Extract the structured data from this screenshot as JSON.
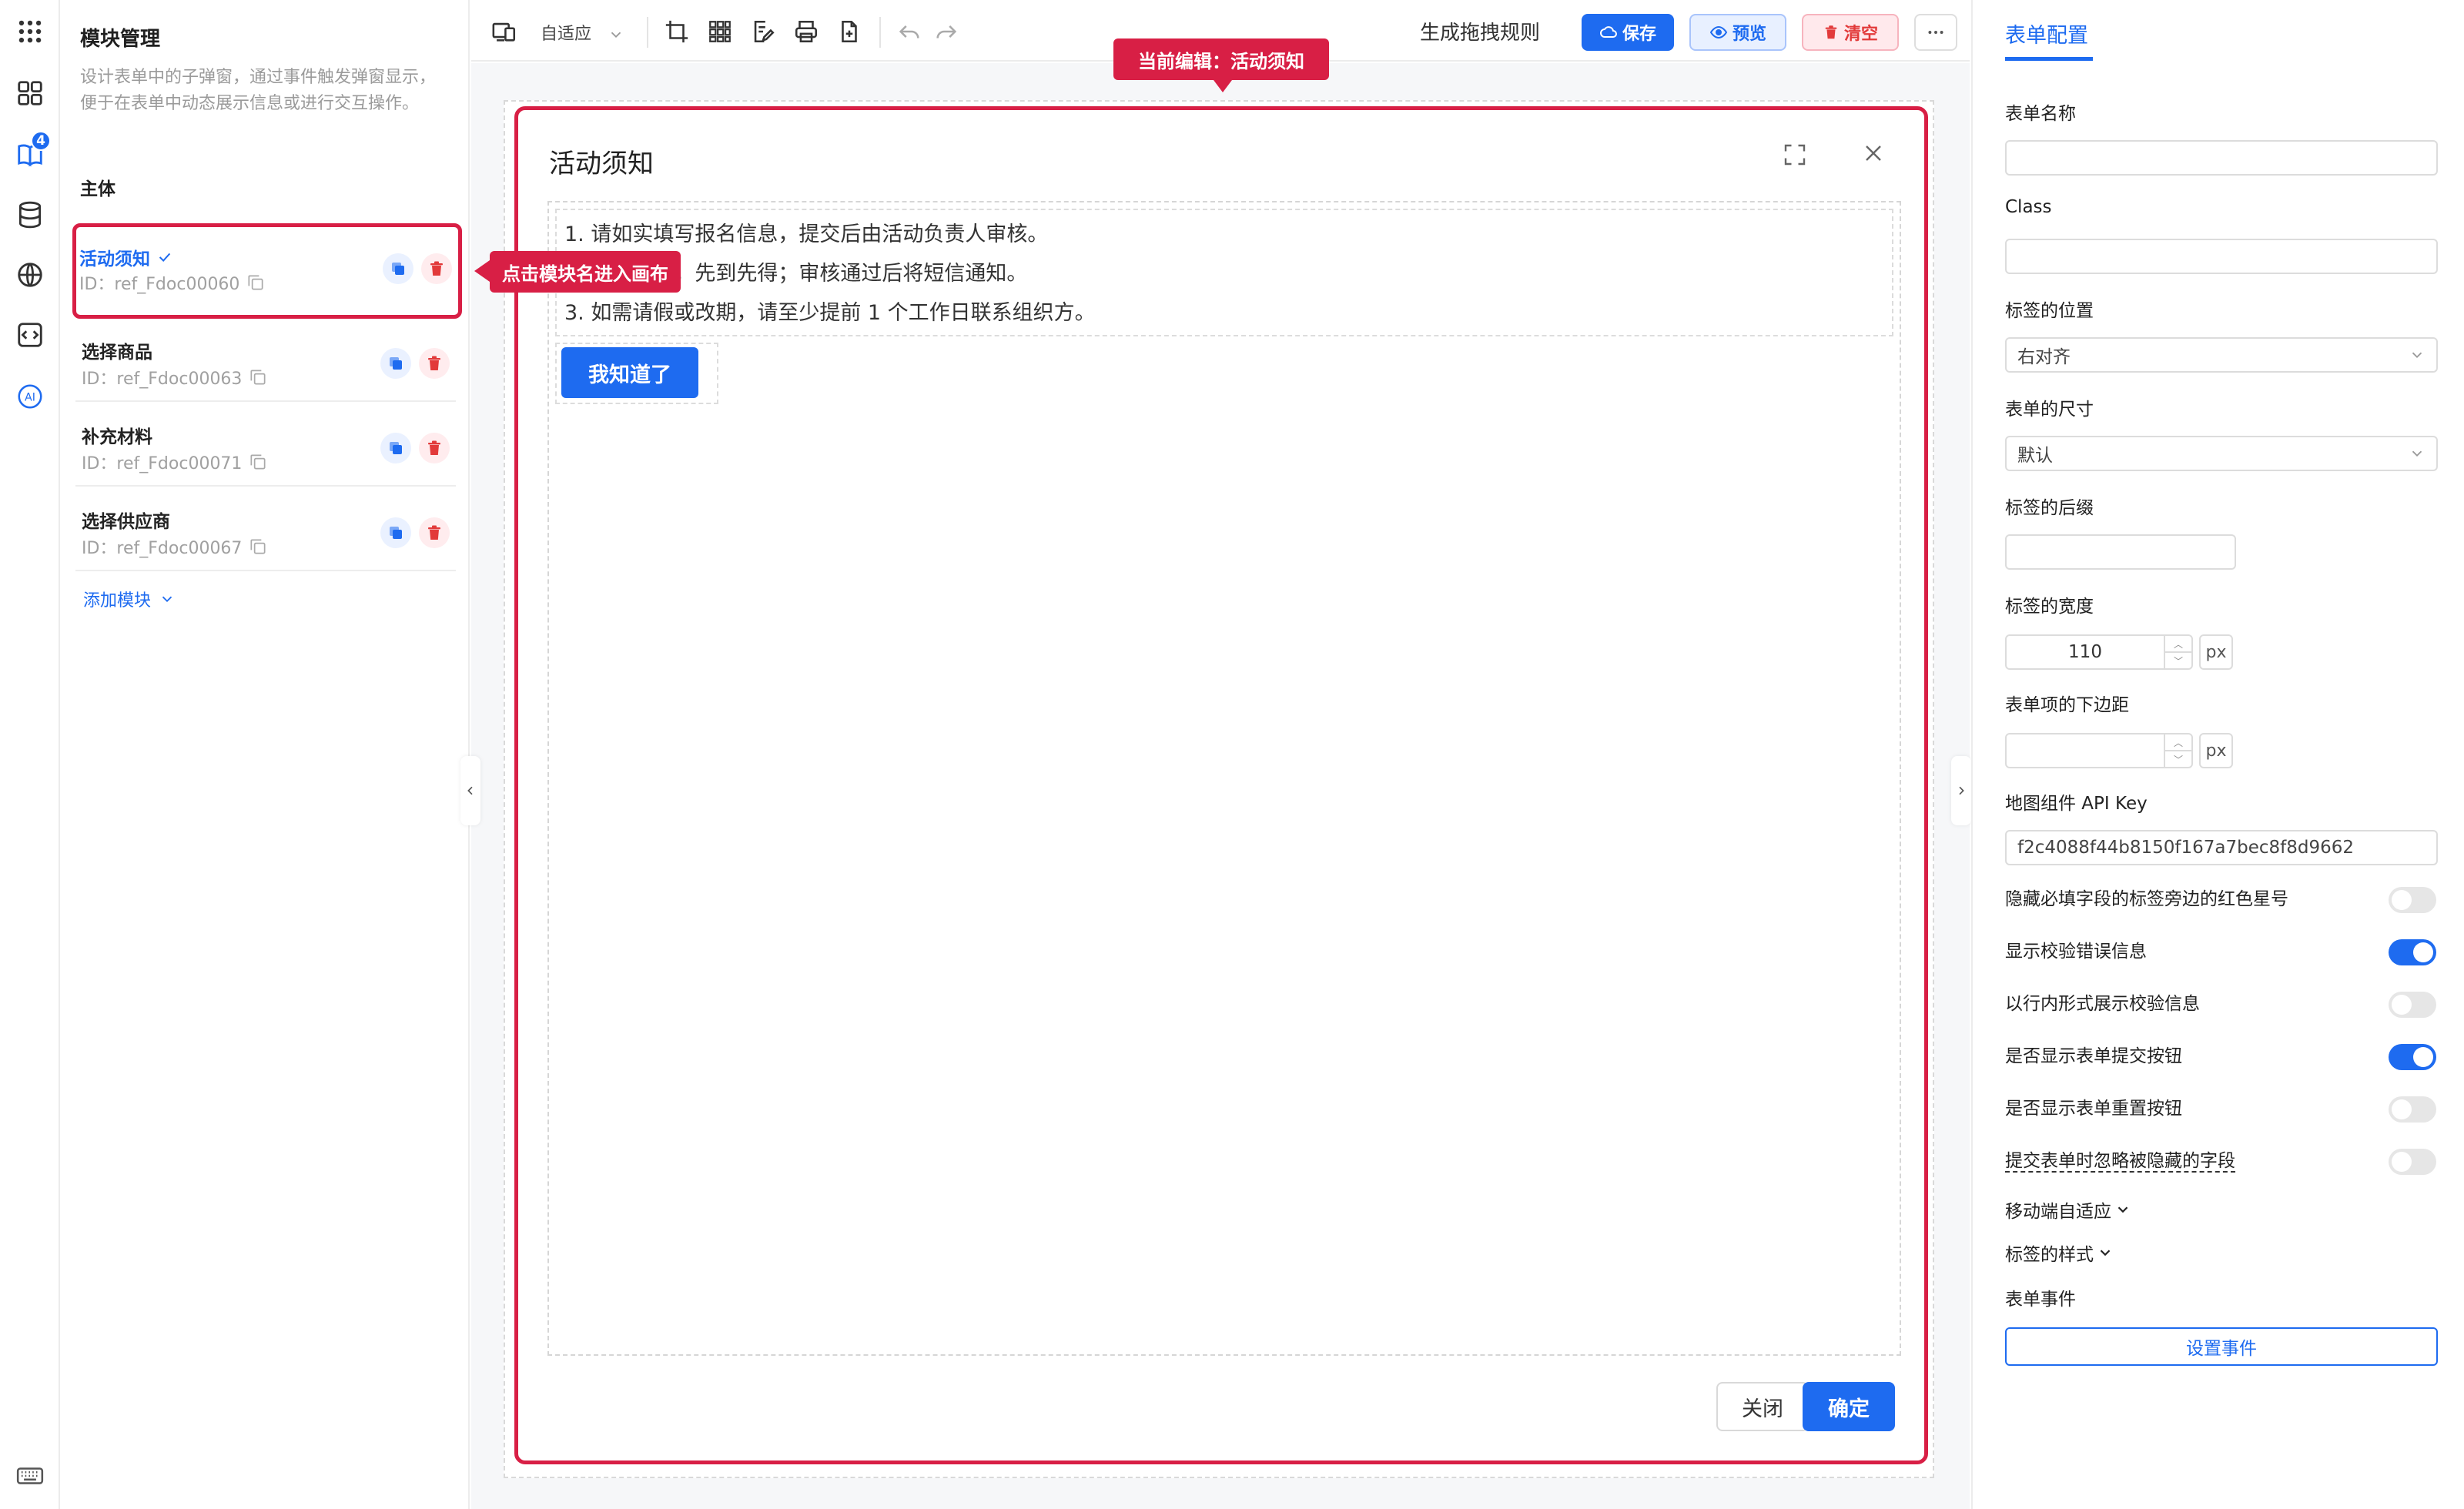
{
  "modules_panel": {
    "title": "模块管理",
    "description": "设计表单中的子弹窗，通过事件触发弹窗显示，便于在表单中动态展示信息或进行交互操作。",
    "section_label": "主体",
    "items": [
      {
        "name": "活动须知",
        "id": "ID：ref_Fdoc00060",
        "active": true
      },
      {
        "name": "选择商品",
        "id": "ID：ref_Fdoc00063",
        "active": false
      },
      {
        "name": "补充材料",
        "id": "ID：ref_Fdoc00071",
        "active": false
      },
      {
        "name": "选择供应商",
        "id": "ID：ref_Fdoc00067",
        "active": false
      }
    ],
    "add_module_label": "添加模块"
  },
  "rail": {
    "badge_count": "4",
    "icons": [
      "grid-dots-icon",
      "apps-icon",
      "book-icon",
      "database-icon",
      "globe-icon",
      "code-icon",
      "ai-icon",
      "keyboard-icon"
    ]
  },
  "toolbar": {
    "adapt_label": "自适应",
    "generate_rule_label": "生成拖拽规则",
    "save_label": "保存",
    "preview_label": "预览",
    "clear_label": "清空"
  },
  "canvas": {
    "callout_editing": "当前编辑：活动须知",
    "callout_enter": "点击模块名进入画布",
    "dialog": {
      "title": "活动须知",
      "notice_lines": [
        "1. 请如实填写报名信息，提交后由活动负责人审核。",
        "2. 名额有限，先到先得；审核通过后将短信通知。",
        "3. 如需请假或改期，请至少提前 1 个工作日联系组织方。"
      ],
      "confirm_notice_button": "我知道了",
      "cancel_label": "关闭",
      "ok_label": "确定"
    }
  },
  "config_panel": {
    "tab_label": "表单配置",
    "form_name_label": "表单名称",
    "form_name_value": "",
    "class_label": "Class",
    "class_value": "",
    "label_position_label": "标签的位置",
    "label_position_value": "右对齐",
    "form_size_label": "表单的尺寸",
    "form_size_value": "默认",
    "label_suffix_label": "标签的后缀",
    "label_suffix_value": "",
    "label_width_label": "标签的宽度",
    "label_width_value": "110",
    "label_width_unit": "px",
    "item_margin_label": "表单项的下边距",
    "item_margin_value": "",
    "item_margin_unit": "px",
    "map_key_label": "地图组件 API Key",
    "map_key_value": "f2c4088f44b8150f167a7bec8f8d9662",
    "switches": [
      {
        "label": "隐藏必填字段的标签旁边的红色星号",
        "on": false
      },
      {
        "label": "显示校验错误信息",
        "on": true
      },
      {
        "label": "以行内形式展示校验信息",
        "on": false
      },
      {
        "label": "是否显示表单提交按钮",
        "on": true
      },
      {
        "label": "是否显示表单重置按钮",
        "on": false
      },
      {
        "label": "提交表单时忽略被隐藏的字段",
        "on": false
      }
    ],
    "mobile_adapt_label": "移动端自适应",
    "label_style_label": "标签的样式",
    "form_events_label": "表单事件",
    "set_event_label": "设置事件"
  },
  "colors": {
    "accent": "#1e6bf0",
    "danger": "#d81f45"
  }
}
